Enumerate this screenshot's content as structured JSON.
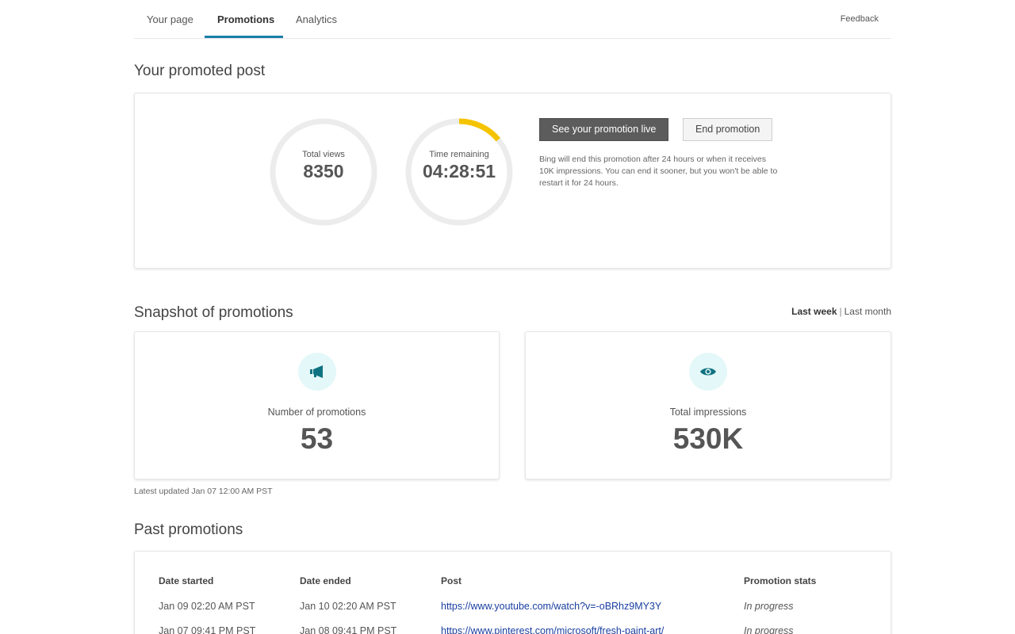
{
  "nav": {
    "tabs": [
      "Your page",
      "Promotions",
      "Analytics"
    ],
    "active_tab": "Promotions",
    "feedback": "Feedback"
  },
  "promoted": {
    "heading": "Your promoted post",
    "views_label": "Total views",
    "views_value": "8350",
    "time_label": "Time remaining",
    "time_value": "04:28:51",
    "time_progress_fraction": 0.14,
    "primary_button": "See your promotion live",
    "secondary_button": "End promotion",
    "note": "Bing will end this promotion after 24 hours or when it receives 10K impressions. You can end it sooner, but you won't be able to restart it for 24 hours."
  },
  "snapshot": {
    "heading": "Snapshot of promotions",
    "range_options": [
      "Last week",
      "Last month"
    ],
    "range_selected": "Last week",
    "promotions_icon": "megaphone-icon",
    "promotions_label": "Number of promotions",
    "promotions_value": "53",
    "impressions_icon": "eye-icon",
    "impressions_label": "Total impressions",
    "impressions_value": "530K",
    "updated": "Latest updated Jan 07 12:00 AM PST"
  },
  "past": {
    "heading": "Past promotions",
    "columns": [
      "Date started",
      "Date ended",
      "Post",
      "Promotion stats"
    ],
    "rows": [
      {
        "started": "Jan 09 02:20 AM PST",
        "ended": "Jan 10 02:20 AM PST",
        "post": "https://www.youtube.com/watch?v=-oBRhz9MY3Y",
        "stats": "In progress"
      },
      {
        "started": "Jan 07 09:41 PM PST",
        "ended": "Jan 08 09:41 PM PST",
        "post": "https://www.pinterest.com/microsoft/fresh-paint-art/",
        "stats": "In progress"
      }
    ]
  },
  "colors": {
    "accent": "#1a7fa8",
    "progress": "#f5c400",
    "ring_track": "#ececec",
    "icon_bg": "#e4f8f9",
    "icon_fg": "#0f7280",
    "link": "#1a3fa0"
  }
}
